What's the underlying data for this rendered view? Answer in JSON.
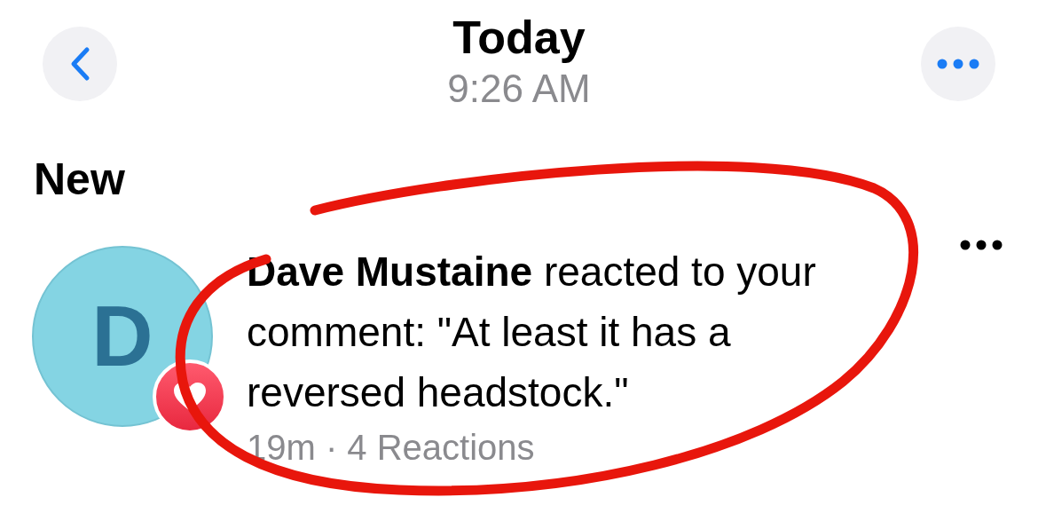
{
  "header": {
    "title": "Today",
    "subtitle": "9:26 AM"
  },
  "section": {
    "title": "New"
  },
  "notifications": [
    {
      "avatar_letter": "D",
      "text": "**Dave Mustaine** reacted to your comment: \"At least it has a reversed headstock.\"",
      "meta": "19m · 4 Reactions"
    }
  ],
  "annotation": {
    "kind": "circle"
  }
}
